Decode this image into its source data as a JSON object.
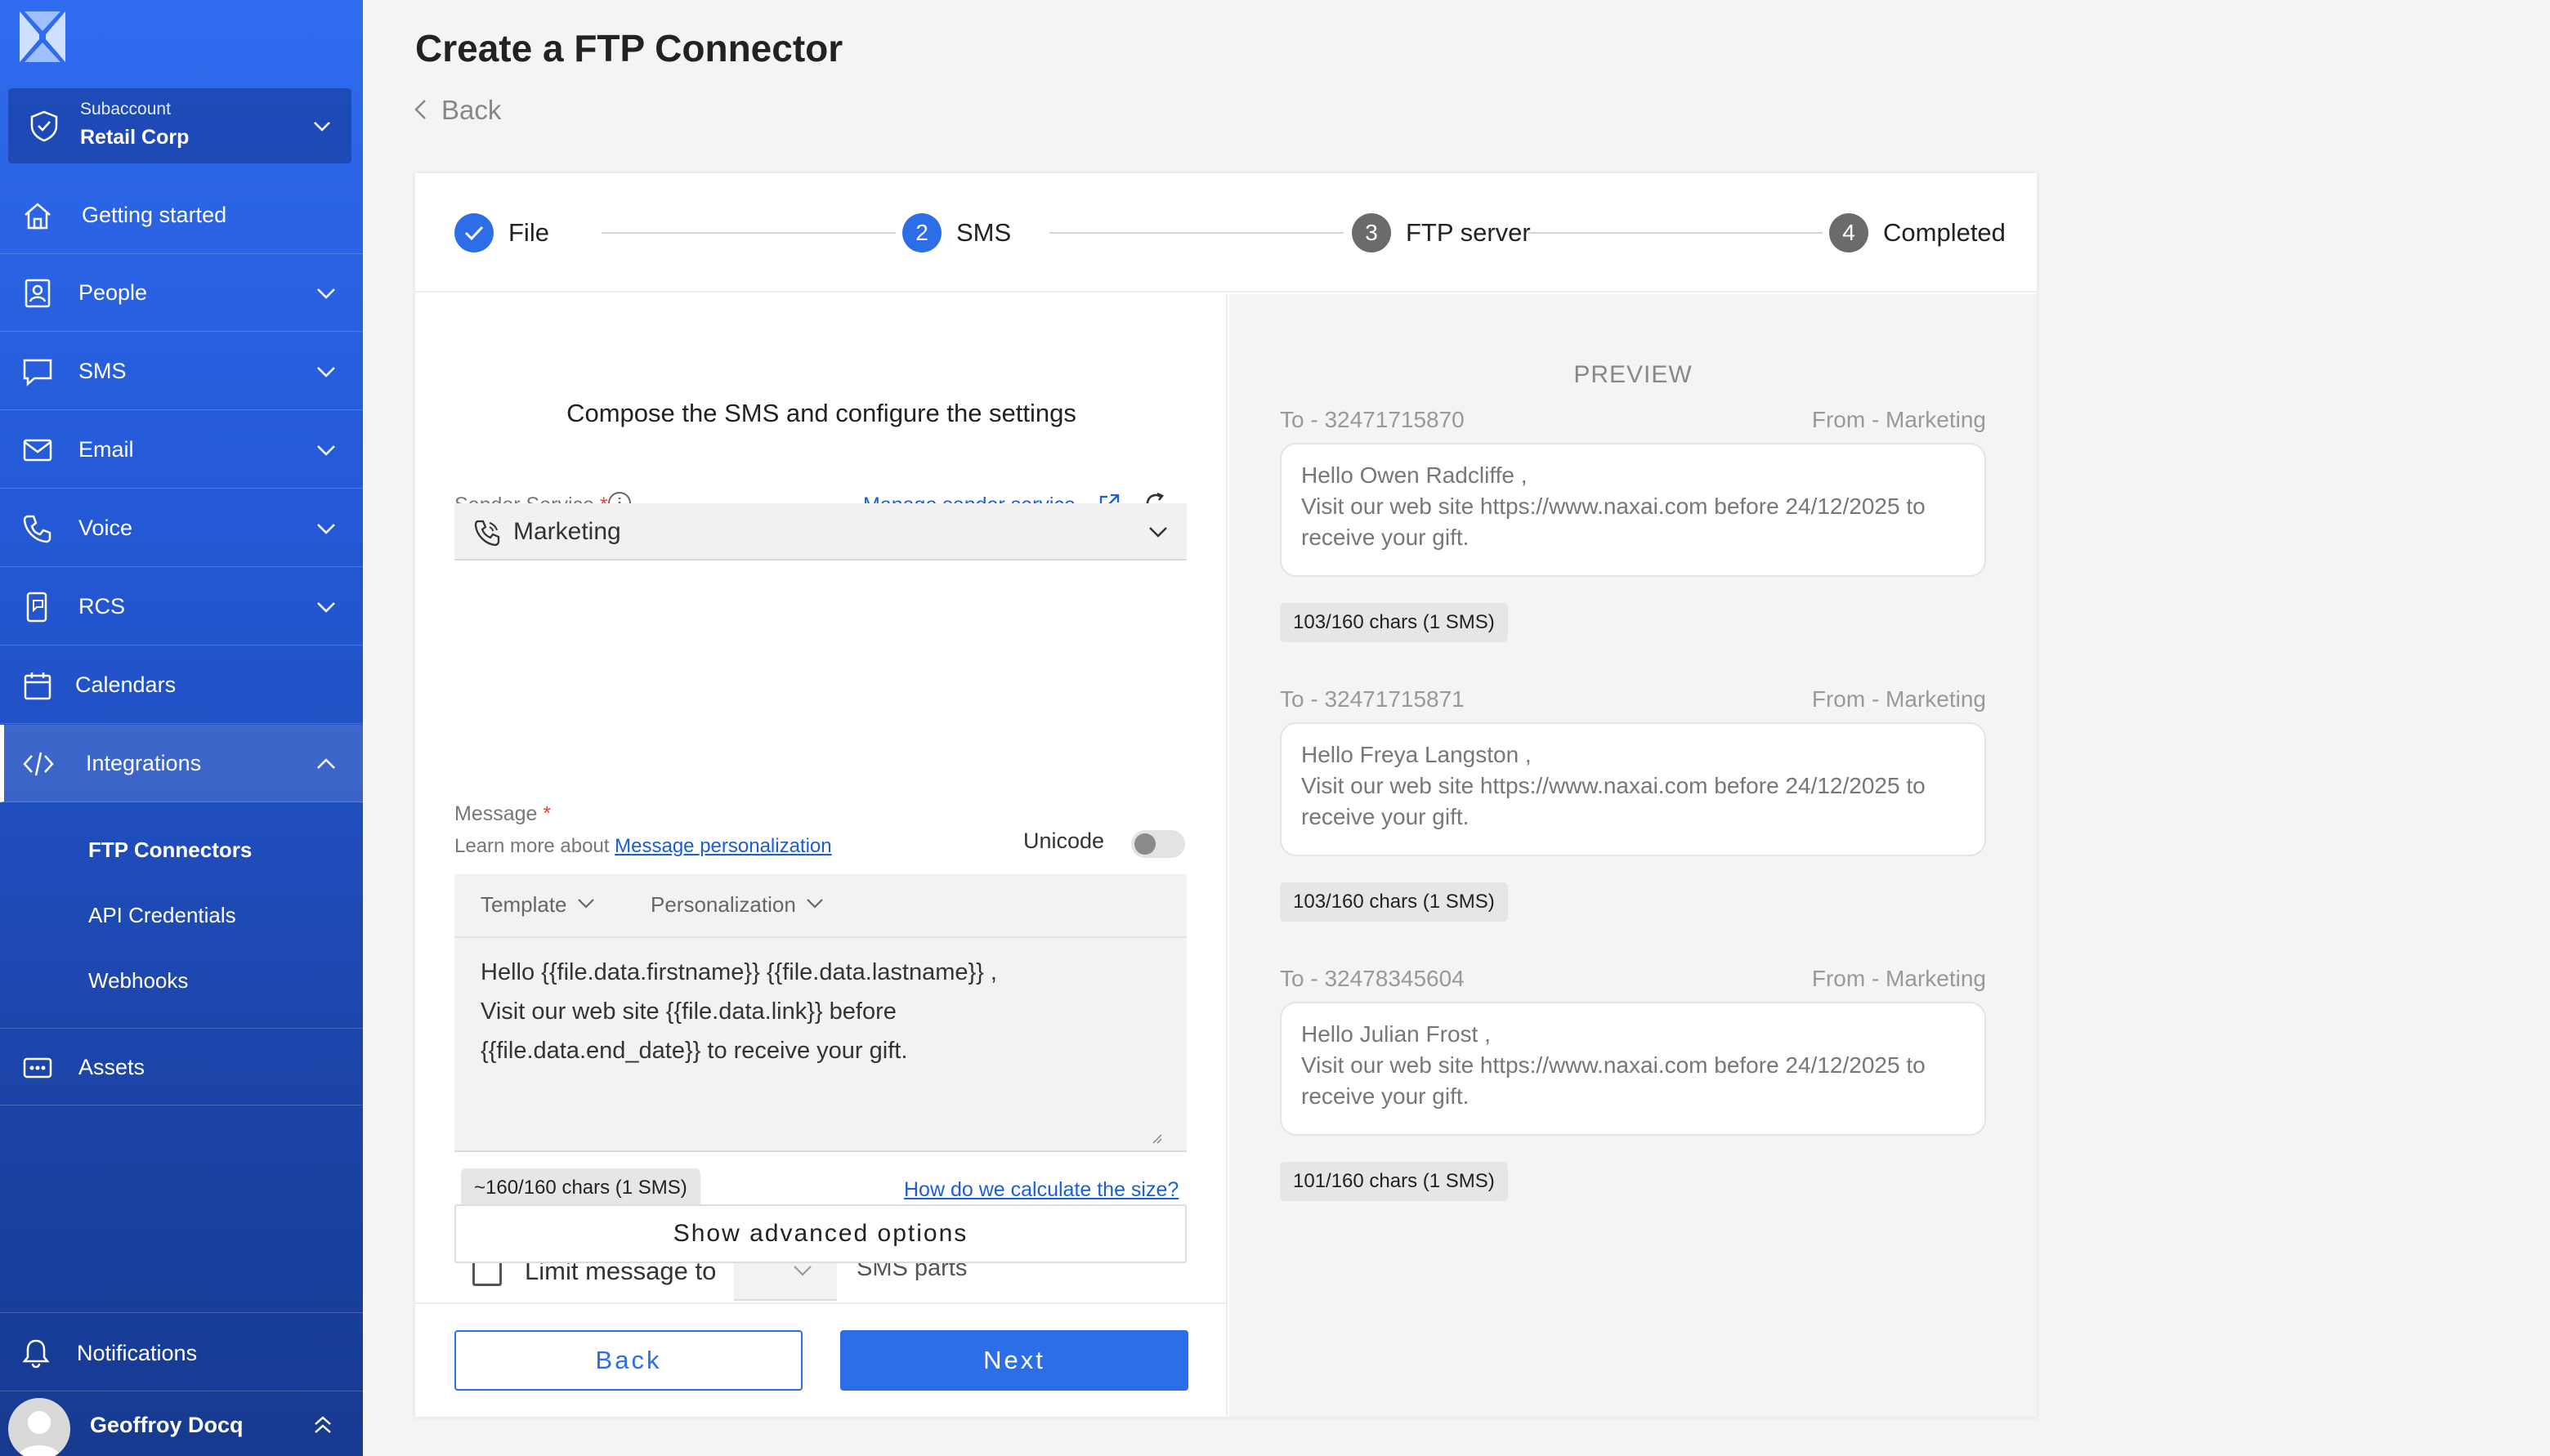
{
  "sidebar": {
    "subaccount_label": "Subaccount",
    "subaccount_name": "Retail Corp",
    "items": [
      {
        "label": "Getting started"
      },
      {
        "label": "People"
      },
      {
        "label": "SMS"
      },
      {
        "label": "Email"
      },
      {
        "label": "Voice"
      },
      {
        "label": "RCS"
      },
      {
        "label": "Calendars"
      },
      {
        "label": "Integrations"
      },
      {
        "label": "Assets"
      }
    ],
    "sub_items": [
      {
        "label": "FTP Connectors"
      },
      {
        "label": "API Credentials"
      },
      {
        "label": "Webhooks"
      }
    ],
    "notifications_label": "Notifications",
    "user_name": "Geoffroy Docq"
  },
  "page": {
    "title": "Create a FTP Connector",
    "back_label": "Back"
  },
  "stepper": {
    "steps": [
      {
        "number": "",
        "label": "File"
      },
      {
        "number": "2",
        "label": "SMS"
      },
      {
        "number": "3",
        "label": "FTP server"
      },
      {
        "number": "4",
        "label": "Completed"
      }
    ]
  },
  "form": {
    "heading": "Compose the SMS and configure the settings",
    "sender_service_label": "Sender Service",
    "required_mark": "*",
    "manage_sender_link": "Manage sender service",
    "sender_value": "Marketing",
    "message_label": "Message",
    "learn_more_prefix": "Learn more about",
    "personalization_link": "Message personalization",
    "unicode_label": "Unicode",
    "template_label": "Template",
    "personalization_label": "Personalization",
    "message_lines": [
      "Hello {{file.data.firstname}} {{file.data.lastname}} ,",
      "Visit our web site {{file.data.link}} before",
      "{{file.data.end_date}} to receive your gift."
    ],
    "chars_count": "~160/160 chars (1 SMS)",
    "size_link": "How do we calculate the size?",
    "limit_label": "Limit message to",
    "parts_label": "SMS parts",
    "advanced_button": "Show advanced options",
    "back_button": "Back",
    "next_button": "Next"
  },
  "preview": {
    "title": "PREVIEW",
    "messages": [
      {
        "to": "To - 32471715870",
        "from": "From - Marketing",
        "lines": [
          "Hello Owen Radcliffe ,",
          "Visit our web site https://www.naxai.com before 24/12/2025 to",
          "receive your gift."
        ],
        "chars": "103/160 chars (1 SMS)"
      },
      {
        "to": "To - 32471715871",
        "from": "From - Marketing",
        "lines": [
          "Hello Freya Langston ,",
          "Visit our web site https://www.naxai.com before 24/12/2025 to",
          "receive your gift."
        ],
        "chars": "103/160 chars (1 SMS)"
      },
      {
        "to": "To - 32478345604",
        "from": "From - Marketing",
        "lines": [
          "Hello Julian Frost ,",
          "Visit our web site https://www.naxai.com before 24/12/2025 to",
          "receive your gift."
        ],
        "chars": "101/160 chars (1 SMS)"
      }
    ]
  },
  "colors": {
    "accent": "#2b6ee8",
    "sidebar_top": "#2f6cf0",
    "sidebar_bottom": "#173a90",
    "step_done": "#2b6ee8",
    "step_pending": "#6b6b6b",
    "required": "#e0483a"
  },
  "icons": [
    "logo-icon",
    "shield-icon",
    "home-icon",
    "people-icon",
    "sms-icon",
    "email-icon",
    "voice-icon",
    "rcs-icon",
    "calendar-icon",
    "code-icon",
    "assets-icon",
    "bell-icon",
    "info-icon",
    "external-link-icon",
    "refresh-icon",
    "phone-icon",
    "check-icon",
    "chevron-down-icon",
    "chevron-up-icon",
    "chevron-left-icon"
  ]
}
